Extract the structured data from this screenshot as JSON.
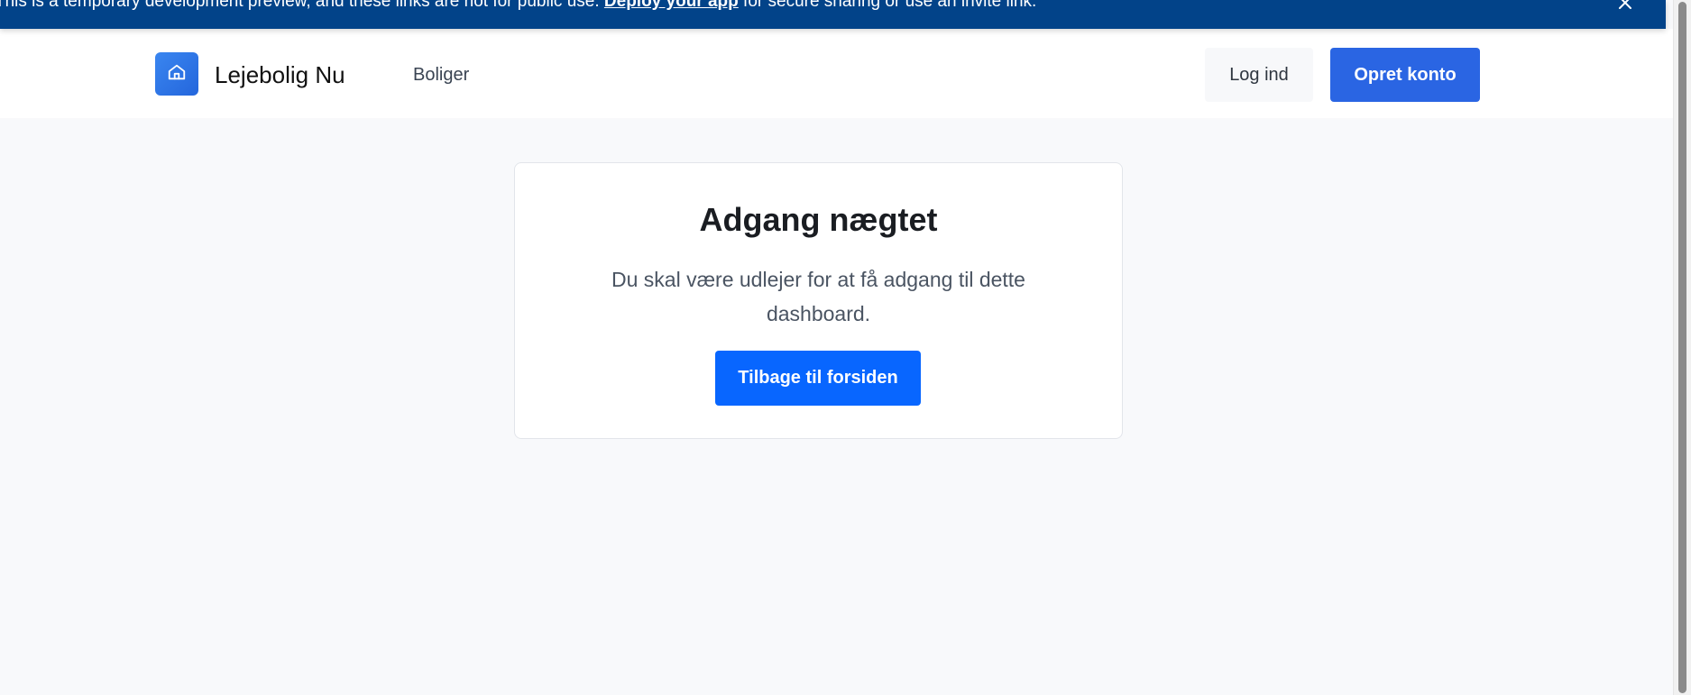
{
  "banner": {
    "text_before": "This is a temporary development preview, and these links are not for public use. ",
    "link_label": "Deploy your app",
    "text_after": " for secure sharing or use an invite link.",
    "close_icon": "close-icon",
    "background": "#024389"
  },
  "header": {
    "brand": "Lejebolig Nu",
    "logo_icon": "home-icon",
    "nav": [
      {
        "label": "Boliger"
      }
    ],
    "login_label": "Log ind",
    "signup_label": "Opret konto",
    "accent": "#2a65e3"
  },
  "card": {
    "title": "Adgang nægtet",
    "message_line1": "Du skal være udlejer for at få adgang til dette",
    "message_line2": "dashboard.",
    "button_label": "Tilbage til forsiden",
    "button_color": "#0866ff"
  }
}
